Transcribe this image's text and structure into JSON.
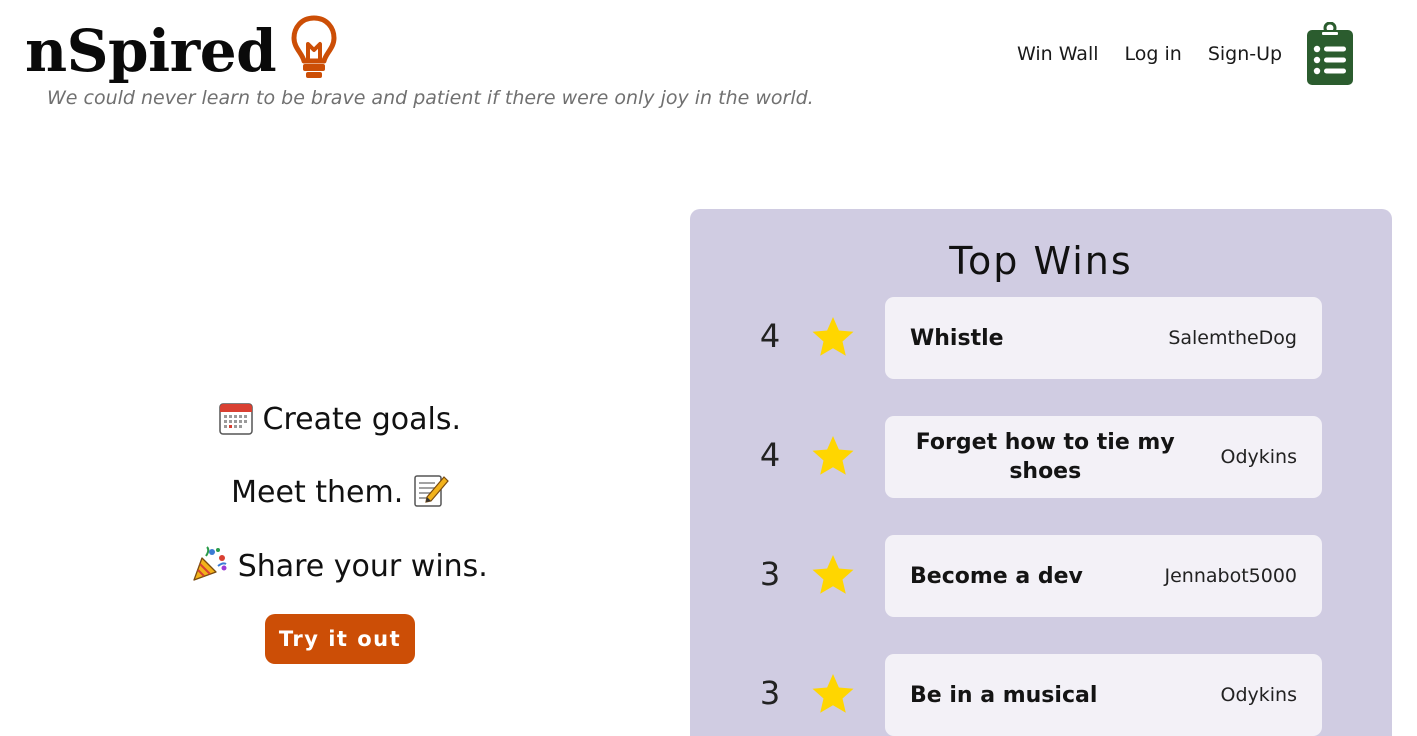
{
  "header": {
    "brand": "nSpired",
    "tagline": "We could never learn to be brave and patient if there were only joy in the world.",
    "nav": {
      "win_wall": "Win Wall",
      "login": "Log in",
      "signup": "Sign-Up"
    },
    "icons": {
      "logo": "lightbulb-icon",
      "menu": "clipboard-list-icon"
    }
  },
  "hero": {
    "line1": {
      "emoji": "📅",
      "text": "Create goals."
    },
    "line2": {
      "text": "Meet them.",
      "emoji": "📝"
    },
    "line3": {
      "emoji": "🎉",
      "text": "Share your wins."
    },
    "cta_label": "Try it out"
  },
  "top_wins": {
    "title": "Top Wins",
    "items": [
      {
        "count": "4",
        "title": "Whistle",
        "user": "SalemtheDog"
      },
      {
        "count": "4",
        "title": "Forget how to tie my shoes",
        "user": "Odykins"
      },
      {
        "count": "3",
        "title": "Become a dev",
        "user": "Jennabot5000"
      },
      {
        "count": "3",
        "title": "Be in a musical",
        "user": "Odykins"
      }
    ]
  },
  "colors": {
    "accent": "#cc4e06",
    "panel": "#d0cce2",
    "card": "#f3f1f7",
    "clipboard": "#2b5c2e",
    "star": "#ffd600"
  }
}
